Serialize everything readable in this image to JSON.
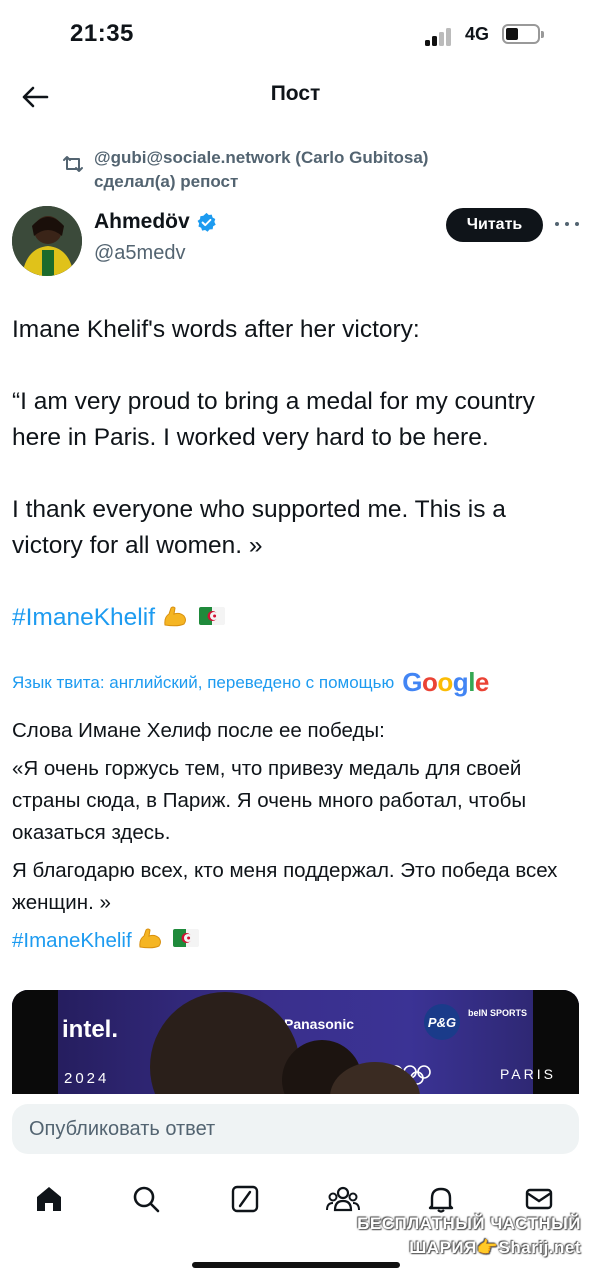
{
  "status_bar": {
    "time": "21:35",
    "network": "4G"
  },
  "header": {
    "title": "Пост"
  },
  "repost": {
    "text": "@gubi@sociale.network (Carlo Gubitosa) сделал(а) репост"
  },
  "author": {
    "name": "Ahmedöv",
    "handle": "@a5medv",
    "follow_label": "Читать"
  },
  "tweet": {
    "line1": "Imane Khelif's words after her victory:",
    "quote": "“I am very proud to bring a medal for my country here in Paris. I worked very hard to be here.",
    "thanks": "I thank everyone who supported me. This is a victory for all women. »",
    "hashtag": "#ImaneKhelif"
  },
  "translation": {
    "notice": "Язык твита: английский, переведено с помощью",
    "provider": "Google",
    "line1": "Слова Имане Хелиф после ее победы:",
    "quote": "«Я очень горжусь тем, что привезу медаль для своей страны сюда, в Париж. Я очень много работал, чтобы оказаться здесь.",
    "thanks": "Я благодарю всех, кто меня поддержал. Это победа всех женщин. »",
    "hashtag": "#ImaneKhelif"
  },
  "media": {
    "intel": "intel.",
    "year": "2024",
    "panasonic": "Panasonic",
    "pg": "P&G",
    "bein": "beIN SPORTS",
    "paris": "PARIS"
  },
  "reply": {
    "placeholder": "Опубликовать ответ"
  },
  "tabs": [
    "home-icon",
    "search-icon",
    "grok-icon",
    "communities-icon",
    "notifications-icon",
    "messages-icon"
  ],
  "watermark": {
    "line1": "БЕСПЛАТНЫЙ ЧАСТНЫЙ",
    "line2": "ШАРИЯ👉Sharij.net"
  },
  "colors": {
    "accent": "#1d9bf0",
    "text": "#0f1419",
    "muted": "#536471"
  }
}
